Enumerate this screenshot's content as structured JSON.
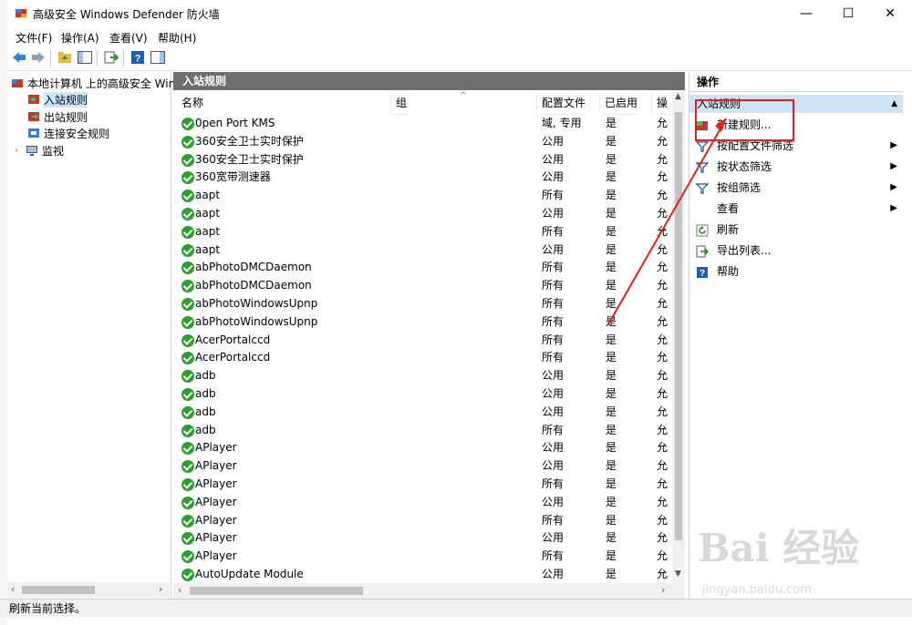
{
  "window": {
    "title": "高级安全 Windows Defender 防火墙",
    "minimize": "—",
    "maximize": "☐",
    "close": "✕"
  },
  "menu": [
    "文件(F)",
    "操作(A)",
    "查看(V)",
    "帮助(H)"
  ],
  "tree": {
    "root": "本地计算机 上的高级安全 Windows Defender 防火墙",
    "items": [
      "入站规则",
      "出站规则",
      "连接安全规则",
      "监视"
    ]
  },
  "main": {
    "header": "入站规则",
    "columns": [
      "名称",
      "组",
      "配置文件",
      "已启用",
      "操"
    ],
    "rows": [
      {
        "name": "0pen Port KMS",
        "profile": "域, 专用",
        "enabled": "是",
        "action": "允"
      },
      {
        "name": "360安全卫士实时保护",
        "profile": "公用",
        "enabled": "是",
        "action": "允"
      },
      {
        "name": "360安全卫士实时保护",
        "profile": "公用",
        "enabled": "是",
        "action": "允"
      },
      {
        "name": "360宽带测速器",
        "profile": "公用",
        "enabled": "是",
        "action": "允"
      },
      {
        "name": "aapt",
        "profile": "所有",
        "enabled": "是",
        "action": "允"
      },
      {
        "name": "aapt",
        "profile": "公用",
        "enabled": "是",
        "action": "允"
      },
      {
        "name": "aapt",
        "profile": "所有",
        "enabled": "是",
        "action": "允"
      },
      {
        "name": "aapt",
        "profile": "公用",
        "enabled": "是",
        "action": "允"
      },
      {
        "name": "abPhotoDMCDaemon",
        "profile": "所有",
        "enabled": "是",
        "action": "允"
      },
      {
        "name": "abPhotoDMCDaemon",
        "profile": "所有",
        "enabled": "是",
        "action": "允"
      },
      {
        "name": "abPhotoWindowsUpnp",
        "profile": "所有",
        "enabled": "是",
        "action": "允"
      },
      {
        "name": "abPhotoWindowsUpnp",
        "profile": "所有",
        "enabled": "是",
        "action": "允"
      },
      {
        "name": "AcerPortalccd",
        "profile": "所有",
        "enabled": "是",
        "action": "允"
      },
      {
        "name": "AcerPortalccd",
        "profile": "所有",
        "enabled": "是",
        "action": "允"
      },
      {
        "name": "adb",
        "profile": "公用",
        "enabled": "是",
        "action": "允"
      },
      {
        "name": "adb",
        "profile": "公用",
        "enabled": "是",
        "action": "允"
      },
      {
        "name": "adb",
        "profile": "公用",
        "enabled": "是",
        "action": "允"
      },
      {
        "name": "adb",
        "profile": "所有",
        "enabled": "是",
        "action": "允"
      },
      {
        "name": "APlayer",
        "profile": "公用",
        "enabled": "是",
        "action": "允"
      },
      {
        "name": "APlayer",
        "profile": "公用",
        "enabled": "是",
        "action": "允"
      },
      {
        "name": "APlayer",
        "profile": "所有",
        "enabled": "是",
        "action": "允"
      },
      {
        "name": "APlayer",
        "profile": "公用",
        "enabled": "是",
        "action": "允"
      },
      {
        "name": "APlayer",
        "profile": "所有",
        "enabled": "是",
        "action": "允"
      },
      {
        "name": "APlayer",
        "profile": "公用",
        "enabled": "是",
        "action": "允"
      },
      {
        "name": "APlayer",
        "profile": "所有",
        "enabled": "是",
        "action": "允"
      },
      {
        "name": "AutoUpdate Module",
        "profile": "公用",
        "enabled": "是",
        "action": "允"
      }
    ]
  },
  "actions": {
    "header": "操作",
    "section": "入站规则",
    "items": [
      {
        "label": "新建规则...",
        "icon": "new-rule-icon",
        "submenu": false
      },
      {
        "label": "按配置文件筛选",
        "icon": "filter-icon",
        "submenu": true
      },
      {
        "label": "按状态筛选",
        "icon": "filter-icon",
        "submenu": true
      },
      {
        "label": "按组筛选",
        "icon": "filter-icon",
        "submenu": true
      },
      {
        "label": "查看",
        "icon": "",
        "submenu": true
      },
      {
        "label": "刷新",
        "icon": "refresh-icon",
        "submenu": false
      },
      {
        "label": "导出列表...",
        "icon": "export-icon",
        "submenu": false
      },
      {
        "label": "帮助",
        "icon": "help-icon",
        "submenu": false
      }
    ]
  },
  "status": "刷新当前选择。",
  "watermark": {
    "brand": "Bai 经验",
    "url": "jingyan.baidu.com"
  },
  "colors": {
    "annotation_red": "#e02020",
    "section_blue": "#cfe3f6",
    "header_gray": "#6e6e6e",
    "ok_green": "#2e9e2e"
  }
}
